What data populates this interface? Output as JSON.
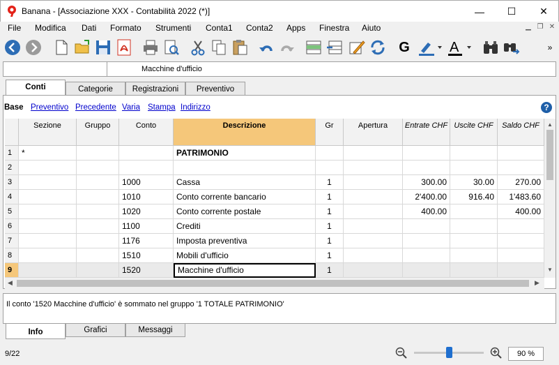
{
  "window": {
    "title": "Banana - [Associazione XXX - Contabilità 2022 (*)]",
    "minimize": "—",
    "maximize": "☐",
    "close": "✕"
  },
  "menu": [
    "File",
    "Modifica",
    "Dati",
    "Formato",
    "Strumenti",
    "Conta1",
    "Conta2",
    "Apps",
    "Finestra",
    "Aiuto"
  ],
  "cellbar": {
    "value": "Macchine d'ufficio"
  },
  "tabs": [
    "Conti",
    "Categorie",
    "Registrazioni",
    "Preventivo"
  ],
  "active_tab": "Conti",
  "views": [
    "Base",
    "Preventivo",
    "Precedente",
    "Varia",
    "Stampa",
    "Indirizzo"
  ],
  "current_view": "Base",
  "help": "?",
  "columns": [
    "Sezione",
    "Gruppo",
    "Conto",
    "Descrizione",
    "Gr",
    "Apertura",
    "Entrate CHF",
    "Uscite CHF",
    "Saldo CHF"
  ],
  "rows": [
    {
      "n": "1",
      "sezione": "*",
      "gruppo": "",
      "conto": "",
      "descrizione": "PATRIMONIO",
      "gr": "",
      "apertura": "",
      "entrate": "",
      "uscite": "",
      "saldo": "",
      "bold": true
    },
    {
      "n": "2",
      "sezione": "",
      "gruppo": "",
      "conto": "",
      "descrizione": "",
      "gr": "",
      "apertura": "",
      "entrate": "",
      "uscite": "",
      "saldo": ""
    },
    {
      "n": "3",
      "sezione": "",
      "gruppo": "",
      "conto": "1000",
      "descrizione": "Cassa",
      "gr": "1",
      "apertura": "",
      "entrate": "300.00",
      "uscite": "30.00",
      "saldo": "270.00"
    },
    {
      "n": "4",
      "sezione": "",
      "gruppo": "",
      "conto": "1010",
      "descrizione": "Conto  corrente bancario",
      "gr": "1",
      "apertura": "",
      "entrate": "2'400.00",
      "uscite": "916.40",
      "saldo": "1'483.60"
    },
    {
      "n": "5",
      "sezione": "",
      "gruppo": "",
      "conto": "1020",
      "descrizione": "Conto corrente postale",
      "gr": "1",
      "apertura": "",
      "entrate": "400.00",
      "uscite": "",
      "saldo": "400.00"
    },
    {
      "n": "6",
      "sezione": "",
      "gruppo": "",
      "conto": "1100",
      "descrizione": "Crediti",
      "gr": "1",
      "apertura": "",
      "entrate": "",
      "uscite": "",
      "saldo": ""
    },
    {
      "n": "7",
      "sezione": "",
      "gruppo": "",
      "conto": "1176",
      "descrizione": "Imposta preventiva",
      "gr": "1",
      "apertura": "",
      "entrate": "",
      "uscite": "",
      "saldo": ""
    },
    {
      "n": "8",
      "sezione": "",
      "gruppo": "",
      "conto": "1510",
      "descrizione": "Mobili d'ufficio",
      "gr": "1",
      "apertura": "",
      "entrate": "",
      "uscite": "",
      "saldo": ""
    },
    {
      "n": "9",
      "sezione": "",
      "gruppo": "",
      "conto": "1520",
      "descrizione": "Macchine d'ufficio",
      "gr": "1",
      "apertura": "",
      "entrate": "",
      "uscite": "",
      "saldo": "",
      "selected": true
    }
  ],
  "info": {
    "message": "Il conto '1520 Macchine d'ufficio' è sommato nel gruppo '1 TOTALE PATRIMONIO'"
  },
  "bottom_tabs": [
    "Info",
    "Grafici",
    "Messaggi"
  ],
  "active_bottom_tab": "Info",
  "status": {
    "position": "9/22",
    "zoom": "90 %",
    "zoom_level": 0.5
  },
  "colors": {
    "header_highlight": "#f5c77a",
    "accent_blue": "#1f5fa8",
    "link": "#0000cc"
  }
}
